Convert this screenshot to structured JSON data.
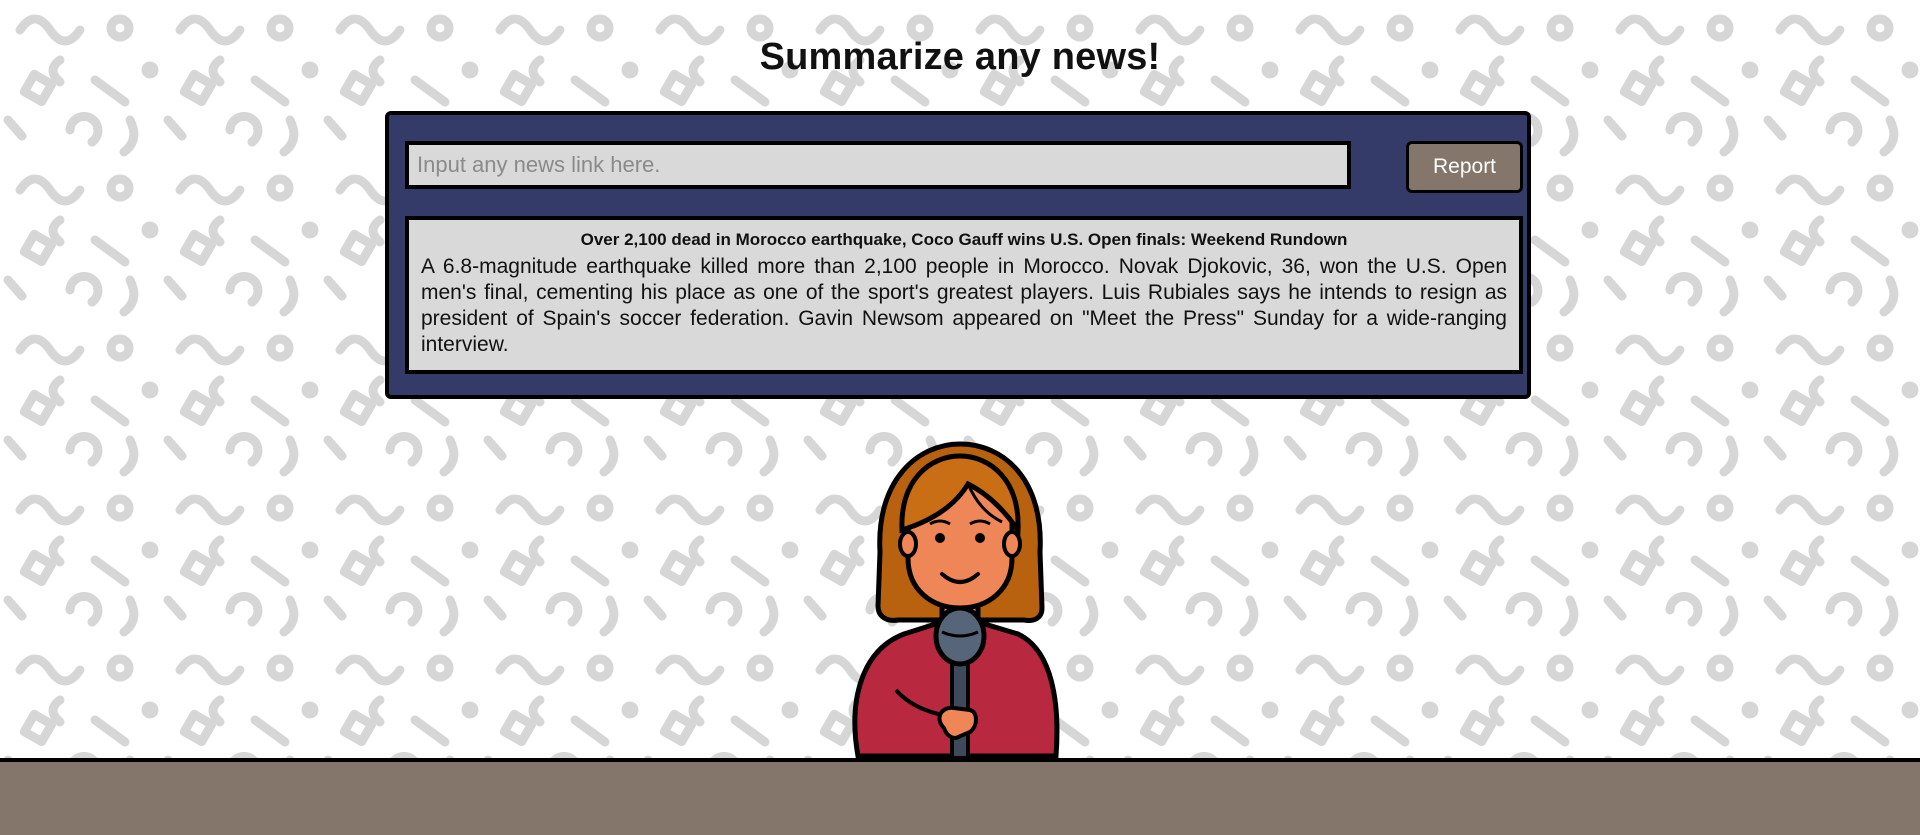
{
  "page": {
    "title": "Summarize any news!"
  },
  "search": {
    "placeholder": "Input any news link here.",
    "value": ""
  },
  "report_button": {
    "label": "Report"
  },
  "summary": {
    "headline": "Over 2,100 dead in Morocco earthquake, Coco Gauff wins U.S. Open finals: Weekend Rundown",
    "body": "A 6.8-magnitude earthquake killed more than 2,100 people in Morocco. Novak Djokovic, 36, won the U.S. Open men's final, cementing his place as one of the sport's greatest players. Luis Rubiales says he intends to resign as president of Spain's soccer federation. Gavin Newsom appeared on \"Meet the Press\" Sunday for a wide-ranging interview."
  },
  "colors": {
    "panel": "#353b68",
    "field": "#d9d9d9",
    "button": "#85766c",
    "desk": "#85766c",
    "pattern": "#d4d4d4"
  },
  "illustration": {
    "icon": "news-anchor-with-microphone-illustration"
  }
}
